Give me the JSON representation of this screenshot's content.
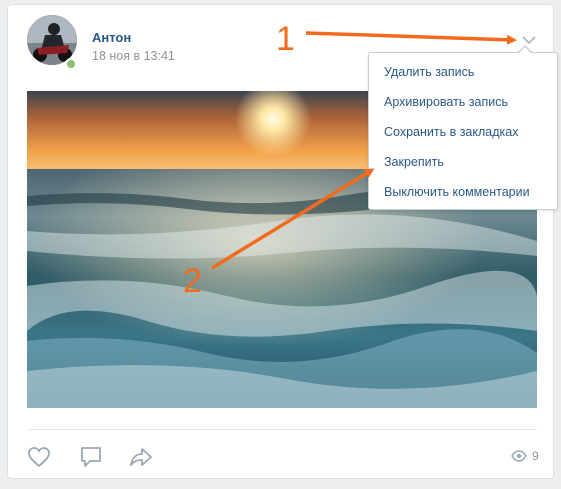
{
  "post": {
    "author": "Антон",
    "date": "18 ноя в 13:41",
    "views": "9"
  },
  "menu": {
    "items": [
      "Удалить запись",
      "Архивировать запись",
      "Сохранить в закладках",
      "Закрепить",
      "Выключить комментарии"
    ]
  },
  "annotations": {
    "label_1": "1",
    "label_2": "2",
    "arrow_color": "#f26b1d"
  },
  "colors": {
    "link_blue": "#2a5885",
    "online_green": "#8ac176",
    "muted_gray": "#939393"
  },
  "icons": [
    "chevron-down-icon",
    "heart-icon",
    "comment-icon",
    "share-icon",
    "eye-icon"
  ]
}
